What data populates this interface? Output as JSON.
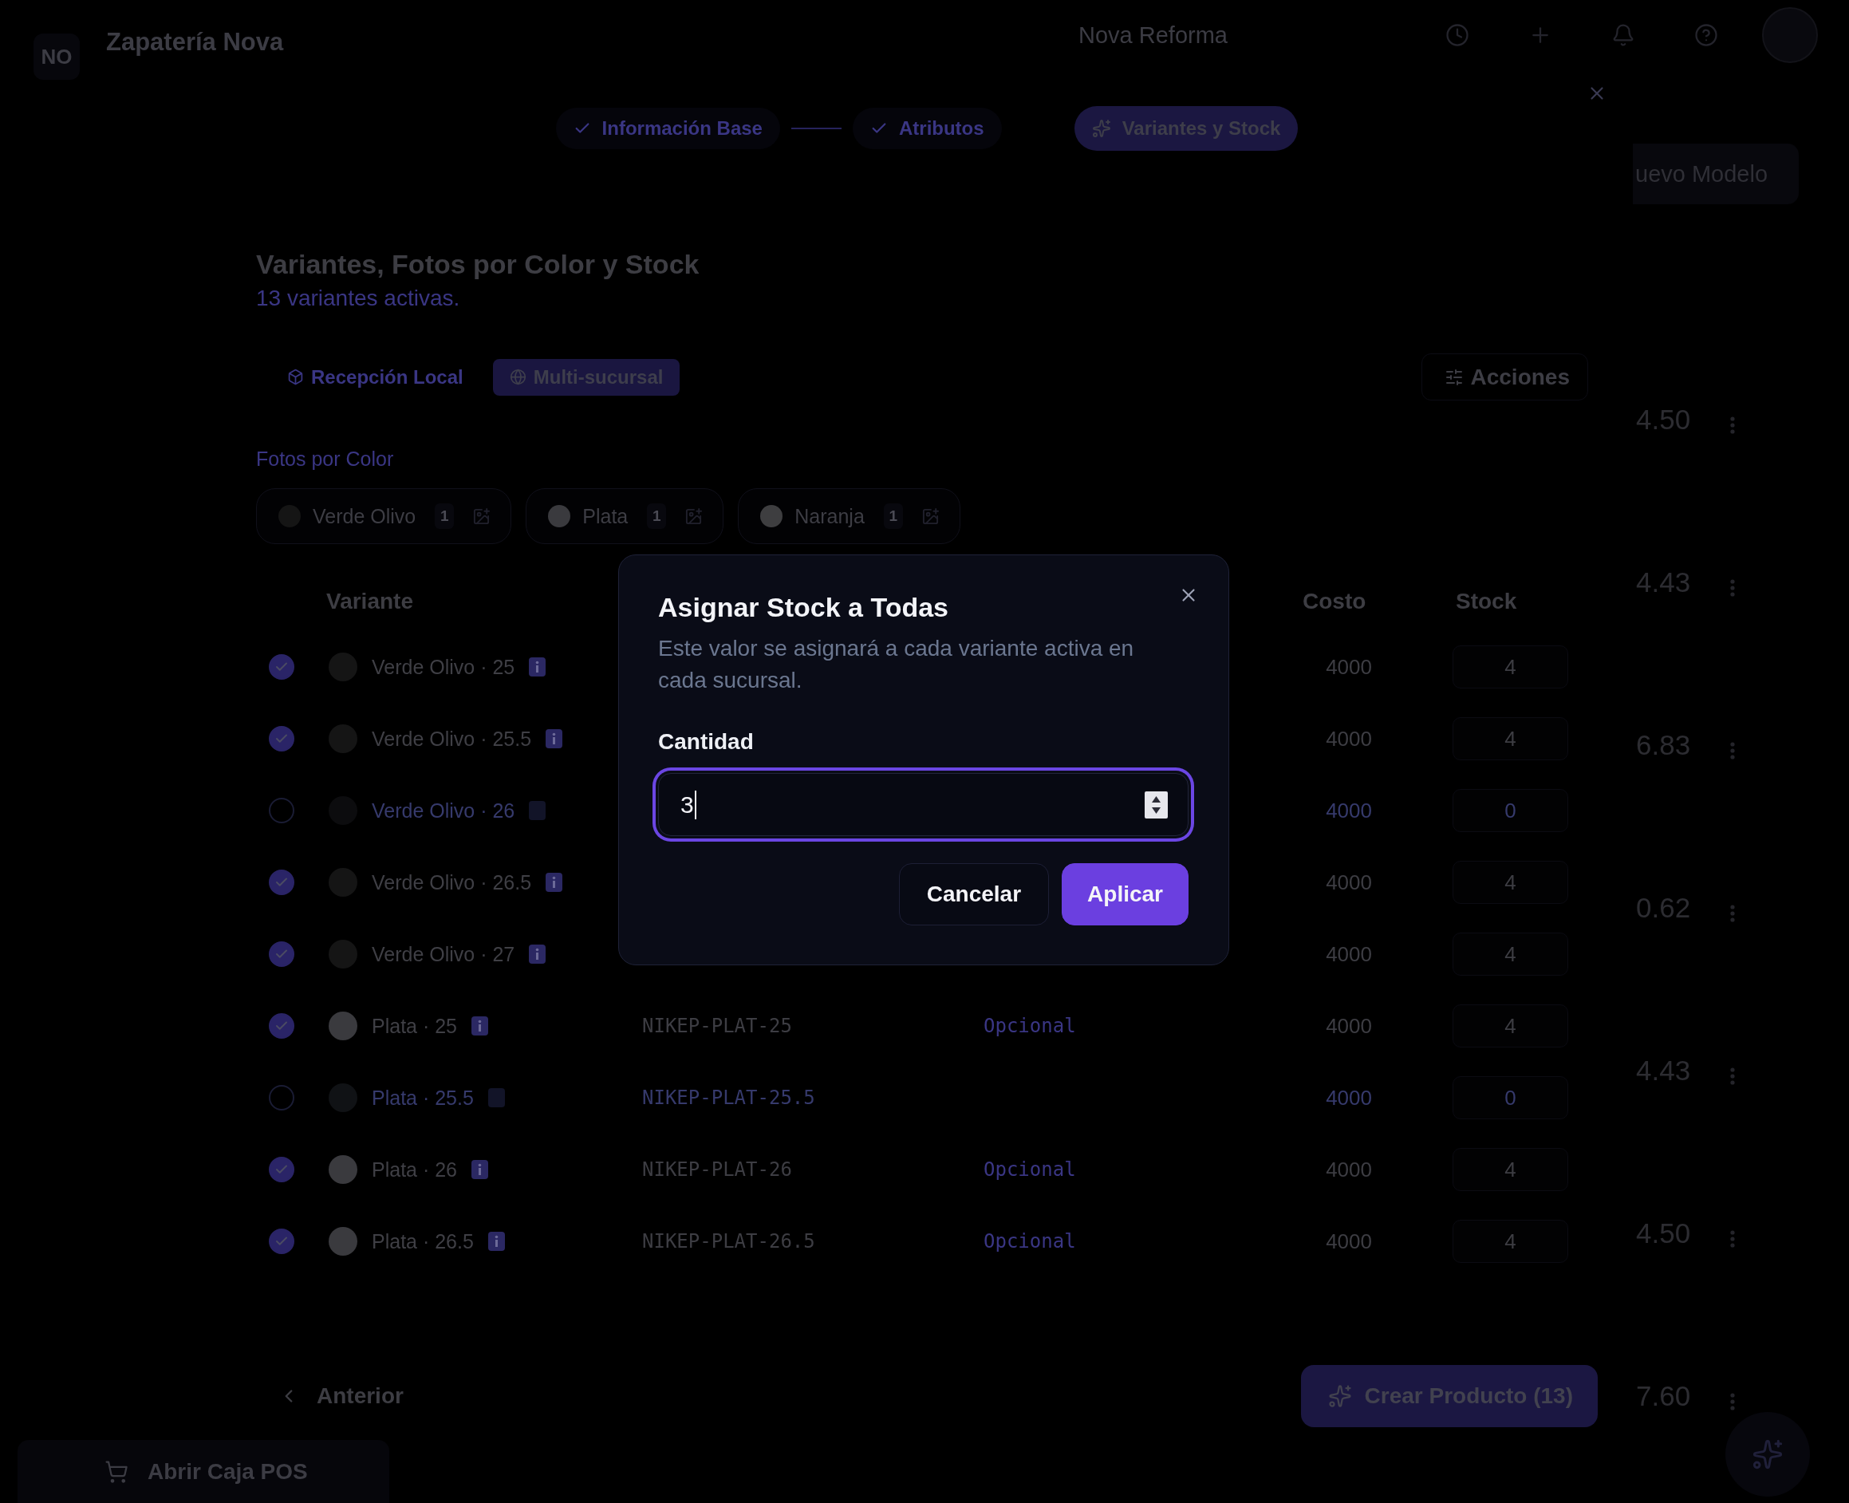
{
  "header": {
    "logo": "NO",
    "store_name": "Zapatería Nova",
    "branch": "Nova Reforma"
  },
  "background": {
    "new_model_button": "uevo Modelo",
    "row_values": [
      "4.50",
      "4.43",
      "6.83",
      "0.62",
      "4.43",
      "4.50",
      "7.60"
    ],
    "pos_button": "Abrir Caja POS"
  },
  "wizard": {
    "steps": [
      {
        "label": "Información Base",
        "done": true,
        "selected": false
      },
      {
        "label": "Atributos",
        "done": true,
        "selected": false
      },
      {
        "label": "Variantes y Stock",
        "done": false,
        "selected": true
      }
    ],
    "title": "Variantes, Fotos por Color y Stock",
    "subtitle": "13 variantes activas.",
    "modes": [
      {
        "label": "Recepción Local",
        "kind": "local",
        "selected": false
      },
      {
        "label": "Multi-sucursal",
        "kind": "multi",
        "selected": true
      }
    ],
    "actions_button": "Acciones",
    "photos_label": "Fotos por Color",
    "color_chips": [
      {
        "name": "Verde Olivo",
        "count": "1",
        "color": "#151515"
      },
      {
        "name": "Plata",
        "count": "1",
        "color": "#3a3a3e"
      },
      {
        "name": "Naranja",
        "count": "1",
        "color": "#3e3e40"
      }
    ],
    "table": {
      "columns": [
        {
          "label": "Variante"
        },
        {
          "label": "Costo"
        },
        {
          "label": "Stock"
        }
      ],
      "rows": [
        {
          "label": "Verde Olivo · 25",
          "checked": true,
          "color": "#151515",
          "cost": "4000",
          "stock": "4"
        },
        {
          "label": "Verde Olivo · 25.5",
          "checked": true,
          "color": "#151515",
          "cost": "4000",
          "stock": "4"
        },
        {
          "label": "Verde Olivo · 26",
          "checked": false,
          "color": "#0c0c0e",
          "cost": "4000",
          "stock": "0"
        },
        {
          "label": "Verde Olivo · 26.5",
          "checked": true,
          "color": "#151515",
          "cost": "4000",
          "stock": "4"
        },
        {
          "label": "Verde Olivo · 27",
          "checked": true,
          "color": "#151515",
          "cost": "4000",
          "stock": "4"
        },
        {
          "label": "Plata · 25",
          "checked": true,
          "color": "#3a3a3e",
          "sku": "NIKEP-PLAT-25",
          "notes_placeholder": "Opcional",
          "cost": "4000",
          "stock": "4"
        },
        {
          "label": "Plata · 25.5",
          "checked": false,
          "color": "#101215",
          "sku": "NIKEP-PLAT-25.5",
          "cost": "4000",
          "stock": "0"
        },
        {
          "label": "Plata · 26",
          "checked": true,
          "color": "#3a3a3e",
          "sku": "NIKEP-PLAT-26",
          "notes_placeholder": "Opcional",
          "cost": "4000",
          "stock": "4"
        },
        {
          "label": "Plata · 26.5",
          "checked": true,
          "color": "#3a3a3e",
          "sku": "NIKEP-PLAT-26.5",
          "notes_placeholder": "Opcional",
          "cost": "4000",
          "stock": "4"
        }
      ]
    },
    "back_button": "Anterior",
    "create_button": "Crear Producto (13)"
  },
  "dialog": {
    "title": "Asignar Stock a Todas",
    "description": "Este valor se asignará a cada variante activa en cada sucursal.",
    "field_label": "Cantidad",
    "value": "3",
    "buttons": [
      {
        "label": "Cancelar",
        "kind": "secondary"
      },
      {
        "label": "Aplicar",
        "kind": "primary"
      }
    ]
  }
}
